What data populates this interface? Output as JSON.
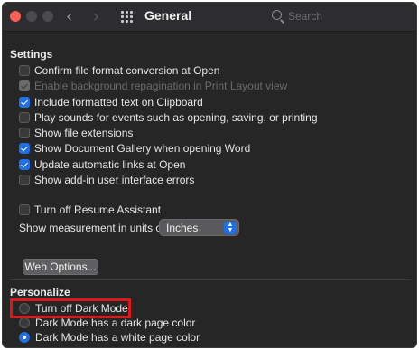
{
  "titlebar": {
    "title": "General",
    "search_placeholder": "Search"
  },
  "settings": {
    "heading": "Settings",
    "options": [
      {
        "label": "Confirm file format conversion at Open",
        "state": "unchecked"
      },
      {
        "label": "Enable background repagination in Print Layout view",
        "state": "disabled"
      },
      {
        "label": "Include formatted text on Clipboard",
        "state": "checked"
      },
      {
        "label": "Play sounds for events such as opening, saving, or printing",
        "state": "unchecked"
      },
      {
        "label": "Show file extensions",
        "state": "unchecked"
      },
      {
        "label": "Show Document Gallery when opening Word",
        "state": "checked"
      },
      {
        "label": "Update automatic links at Open",
        "state": "checked"
      },
      {
        "label": "Show add-in user interface errors",
        "state": "unchecked"
      },
      {
        "label": "Turn off Resume Assistant",
        "state": "unchecked"
      }
    ],
    "measurement_label": "Show measurement in units of:",
    "measurement_value": "Inches",
    "web_options_label": "Web Options..."
  },
  "personalize": {
    "heading": "Personalize",
    "options": [
      {
        "label": "Turn off Dark Mode",
        "selected": false
      },
      {
        "label": "Dark Mode has a dark page color",
        "selected": false
      },
      {
        "label": "Dark Mode has a white page color",
        "selected": true
      }
    ]
  },
  "colors": {
    "accent": "#1f6fe5",
    "highlight": "#e0161b",
    "background": "#262627"
  }
}
